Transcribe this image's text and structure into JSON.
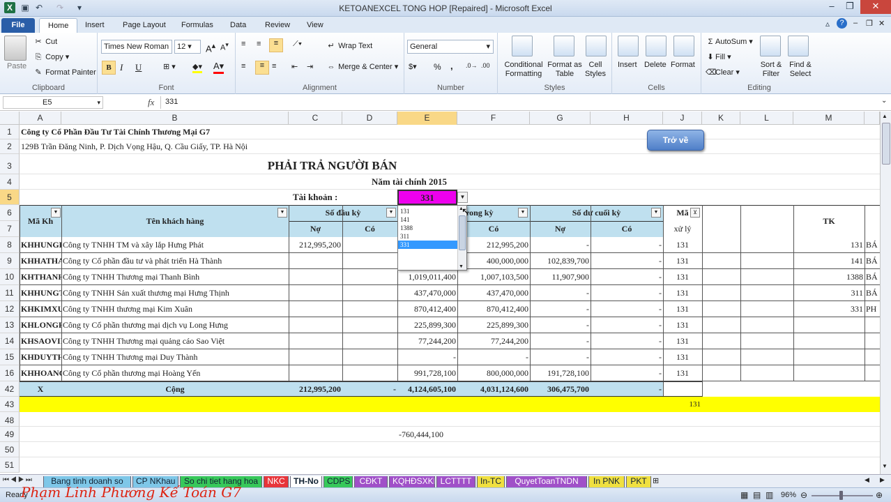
{
  "window": {
    "title": "KETOANEXCEL TONG HOP [Repaired]  -  Microsoft Excel"
  },
  "ribbon_tabs": [
    "File",
    "Home",
    "Insert",
    "Page Layout",
    "Formulas",
    "Data",
    "Review",
    "View"
  ],
  "clipboard": {
    "paste": "Paste",
    "cut": "Cut",
    "copy": "Copy",
    "format_painter": "Format Painter",
    "label": "Clipboard"
  },
  "font": {
    "name": "Times New Roman",
    "size": "12",
    "label": "Font",
    "bold": "B",
    "italic": "I",
    "underline": "U"
  },
  "alignment": {
    "wrap": "Wrap Text",
    "merge": "Merge & Center",
    "label": "Alignment"
  },
  "number": {
    "format": "General",
    "label": "Number",
    "percent": "%",
    "comma": ","
  },
  "styles": {
    "conditional": "Conditional Formatting",
    "format_table": "Format as Table",
    "cell_styles": "Cell Styles",
    "label": "Styles"
  },
  "cells": {
    "insert": "Insert",
    "delete": "Delete",
    "format": "Format",
    "label": "Cells"
  },
  "editing": {
    "autosum": "AutoSum",
    "fill": "Fill",
    "clear": "Clear",
    "sort": "Sort & Filter",
    "find": "Find & Select",
    "label": "Editing"
  },
  "formula_bar": {
    "name_box": "E5",
    "fx": "fx",
    "value": "331"
  },
  "columns": [
    "A",
    "B",
    "C",
    "D",
    "E",
    "F",
    "G",
    "H",
    "J",
    "K",
    "L",
    "M"
  ],
  "rows": [
    "1",
    "2",
    "3",
    "4",
    "5",
    "6",
    "7",
    "8",
    "9",
    "10",
    "11",
    "12",
    "13",
    "14",
    "15",
    "16",
    "42",
    "43",
    "48",
    "49",
    "50",
    "51"
  ],
  "sheet": {
    "company": "Công ty Cổ Phần Đầu Tư Tài Chính Thương Mại G7",
    "address": "129B Trần Đăng Ninh, P. Dịch Vọng Hậu, Q. Cầu Giấy, TP. Hà Nội",
    "title": "PHẢI TRẢ NGƯỜI BÁN",
    "year": "Năm tài chính 2015",
    "account_label": "Tài khoản :",
    "account_value": "331",
    "back_button": "Trở về",
    "h_ma_kh": "Mã Kh",
    "h_ten": "Tên khách hàng",
    "h_sodu_dau": "Số đầu kỳ",
    "h_trong_ky": "rong kỳ",
    "h_sodu_cuoi": "Số dư cuối kỳ",
    "h_ma_xu_ly": "Mã",
    "h_xu_ly": "xử lý",
    "h_tk": "TK",
    "h_no": "Nợ",
    "h_co": "Có",
    "data_rows": [
      {
        "code": "KHHUNGP",
        "name": "Công ty TNHH TM và xây lắp Hưng Phát",
        "c": "212,995,200",
        "d": "",
        "e": "",
        "f": "212,995,200",
        "g": "-",
        "h": "-",
        "j": "131",
        "m": "131",
        "n": "BÁ"
      },
      {
        "code": "KHHATHA",
        "name": "Công ty Cổ phần đầu tư và phát triển Hà Thành",
        "c": "",
        "d": "",
        "e": "",
        "f": "400,000,000",
        "g": "102,839,700",
        "h": "-",
        "j": "131",
        "m": "141",
        "n": "BÁ"
      },
      {
        "code": "KHTHANH",
        "name": "Công ty TNHH Thương mại Thanh Bình",
        "c": "",
        "d": "",
        "e": "1,019,011,400",
        "f": "1,007,103,500",
        "g": "11,907,900",
        "h": "-",
        "j": "131",
        "m": "1388",
        "n": "BÁ"
      },
      {
        "code": "KHHUNGT",
        "name": "Công ty TNHH Sản xuất thương mại Hưng Thịnh",
        "c": "",
        "d": "",
        "e": "437,470,000",
        "f": "437,470,000",
        "g": "-",
        "h": "-",
        "j": "131",
        "m": "311",
        "n": "BÁ"
      },
      {
        "code": "KHKIMXU",
        "name": "Công ty TNHH thương mại Kim Xuân",
        "c": "",
        "d": "",
        "e": "870,412,400",
        "f": "870,412,400",
        "g": "-",
        "h": "-",
        "j": "131",
        "m": "331",
        "n": "PH"
      },
      {
        "code": "KHLONGH",
        "name": "Công ty Cổ phần thương mại dịch vụ Long Hưng",
        "c": "",
        "d": "",
        "e": "225,899,300",
        "f": "225,899,300",
        "g": "-",
        "h": "-",
        "j": "131",
        "m": "",
        "n": ""
      },
      {
        "code": "KHSAOVII",
        "name": "Công ty TNHH Thương mại quảng cáo Sao Việt",
        "c": "",
        "d": "",
        "e": "77,244,200",
        "f": "77,244,200",
        "g": "-",
        "h": "-",
        "j": "131",
        "m": "",
        "n": ""
      },
      {
        "code": "KHDUYTH",
        "name": "Công ty TNHH Thương mại Duy Thành",
        "c": "",
        "d": "",
        "e": "-",
        "f": "-",
        "g": "-",
        "h": "-",
        "j": "131",
        "m": "",
        "n": ""
      },
      {
        "code": "KHHOANG",
        "name": "Công ty Cổ phần thương mại Hoàng Yến",
        "c": "",
        "d": "",
        "e": "991,728,100",
        "f": "800,000,000",
        "g": "191,728,100",
        "h": "-",
        "j": "131",
        "m": "",
        "n": ""
      }
    ],
    "total": {
      "a": "X",
      "b": "Cộng",
      "c": "212,995,200",
      "d": "-",
      "e": "4,124,605,100",
      "f": "4,031,124,600",
      "g": "306,475,700",
      "h": "-"
    },
    "row43_value": "131",
    "row49_value": "-760,444,100"
  },
  "dropdown": {
    "options": [
      "131",
      "141",
      "1388",
      "311",
      "331"
    ],
    "selected": "331"
  },
  "sheet_tabs": [
    "Bang tinh doanh so",
    "CP NKhau",
    "So chi tiet hang hoa",
    "NKC",
    "TH-No",
    "CDPS",
    "CĐKT",
    "KQHĐSXKD",
    "LCTTTT",
    "In-TC",
    "QuyetToanTNDN",
    "In PNK",
    "PKT"
  ],
  "sheet_tab_colors": [
    "#7ec7e8",
    "#7ec7e8",
    "#37c85a",
    "#e8353a",
    "#ffffff",
    "#37c85a",
    "#a050c8",
    "#a050c8",
    "#a050c8",
    "#f0e040",
    "#a050c8",
    "#f0e040",
    "#f0e040"
  ],
  "status": {
    "ready": "Ready",
    "zoom": "96%"
  },
  "watermark": "Phạm Linh Phương Kế Toán G7"
}
